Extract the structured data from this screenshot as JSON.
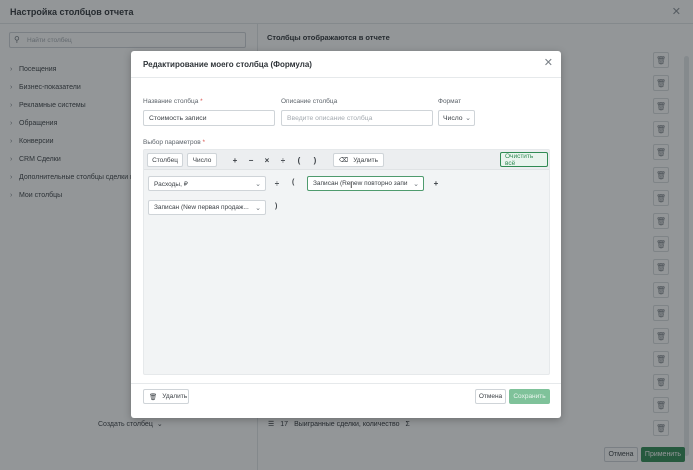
{
  "background": {
    "title": "Настройка столбцов отчета",
    "search_placeholder": "Найти столбец",
    "categories": [
      "Посещения",
      "Бизнес-показатели",
      "Рекламные системы",
      "Обращения",
      "Конверсии",
      "CRM Сделки",
      "Дополнительные столбцы сделки и",
      "Мои столбцы"
    ],
    "create_column": "Создать столбец",
    "right_title": "Столбцы отображаются в отчете",
    "bottom_item": {
      "index": "17",
      "label": "Выигранные сделки, количество",
      "sigma": "Σ"
    },
    "cancel": "Отмена",
    "apply": "Применить"
  },
  "modal": {
    "title": "Редактирование моего столбца (Формула)",
    "name_label": "Название столбца",
    "name_value": "Стоимость записи",
    "description_label": "Описание столбца",
    "description_placeholder": "Введите описание столбца",
    "format_label": "Формат",
    "format_value": "Число",
    "params_label": "Выбор параметров",
    "toolbar": {
      "column_btn": "Столбец",
      "number_btn": "Число",
      "ops": [
        "+",
        "−",
        "×",
        "÷",
        "(",
        ")"
      ],
      "delete_btn": "Удалить",
      "clear_all": "Очистить всё"
    },
    "formula": {
      "row1": {
        "chip1": "Расходы, ₽",
        "op": "÷",
        "open_paren": "(",
        "chip2": "Записан (Renew повторно запи",
        "plus": "+"
      },
      "row2": {
        "chip1": "Записан (New первая продаж...",
        "close_paren": ")"
      }
    },
    "footer": {
      "delete": "Удалить",
      "cancel": "Отмена",
      "save": "Сохранить"
    }
  }
}
